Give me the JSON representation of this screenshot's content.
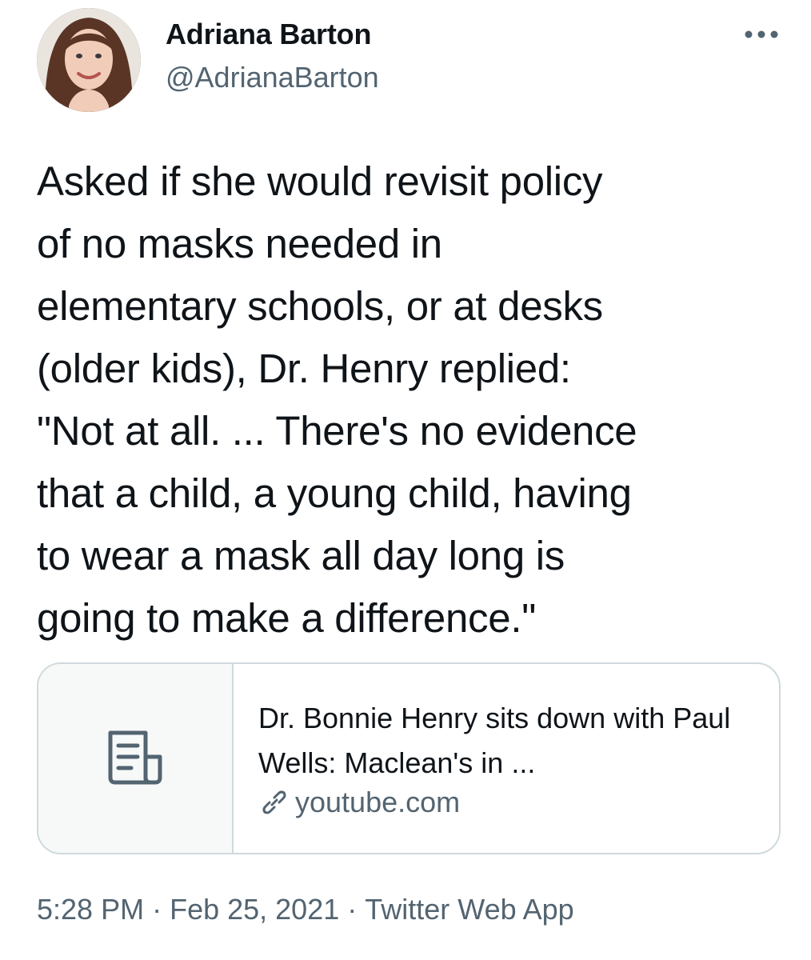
{
  "author": {
    "display_name": "Adriana Barton",
    "handle": "@AdrianaBarton",
    "avatar_icon": "profile-photo"
  },
  "more_icon": "more-horizontal-icon",
  "tweet": {
    "text": "Asked if she would revisit policy\nof no masks needed in\nelementary schools, or at desks\n(older kids), Dr. Henry replied:\n\"Not at all. ... There's no evidence\nthat a child, a young child, having\nto wear a mask all day long is\ngoing to make a difference.\""
  },
  "link_card": {
    "thumbnail_icon": "article-icon",
    "title": "Dr. Bonnie Henry sits down with Paul Wells: Maclean's in ...",
    "domain_icon": "link-icon",
    "domain": "youtube.com"
  },
  "meta": {
    "time": "5:28 PM",
    "date": "Feb 25, 2021",
    "source": "Twitter Web App",
    "separator": "·"
  },
  "colors": {
    "text_primary": "#0f1419",
    "text_secondary": "#536471",
    "border": "#cfd9de",
    "card_thumb_bg": "#f7f9f9"
  }
}
